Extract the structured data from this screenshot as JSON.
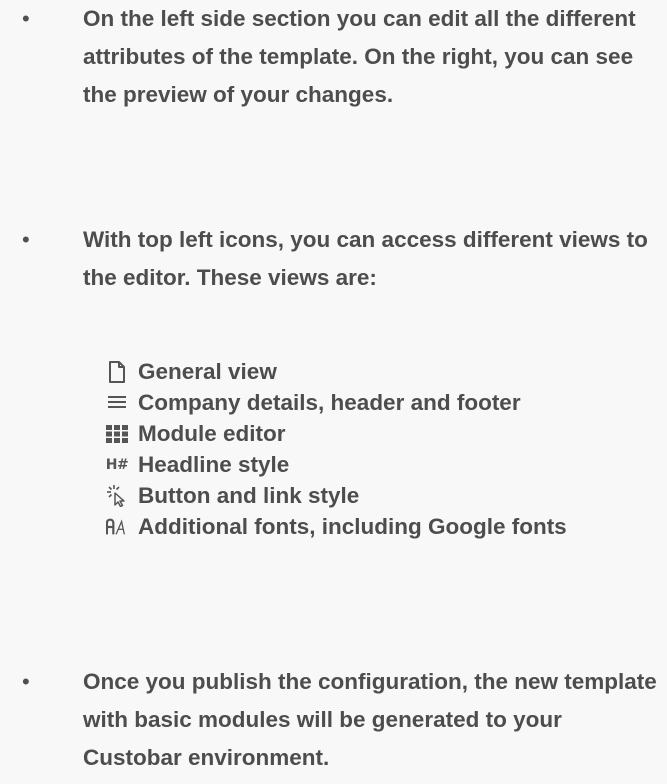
{
  "bullets": [
    {
      "marker": "•",
      "text": "On the left side section you can edit all the different attributes of the template. On the right, you can see the preview of your changes."
    },
    {
      "marker": "•",
      "text": "With top left icons, you can access different views to the editor. These views are:"
    },
    {
      "marker": "•",
      "text": "Once you publish the configuration, the new template with basic modules will be generated to your Custobar environment."
    }
  ],
  "views": [
    {
      "icon": "document-icon",
      "label": "General view"
    },
    {
      "icon": "lines-icon",
      "label": "Company details, header and footer"
    },
    {
      "icon": "grid-icon",
      "label": "Module editor"
    },
    {
      "icon": "headline-icon",
      "label": "Headline style",
      "icon_text": "H#"
    },
    {
      "icon": "cursor-click-icon",
      "label": "Button and link style"
    },
    {
      "icon": "fonts-icon",
      "label": "Additional fonts, including Google fonts"
    }
  ]
}
